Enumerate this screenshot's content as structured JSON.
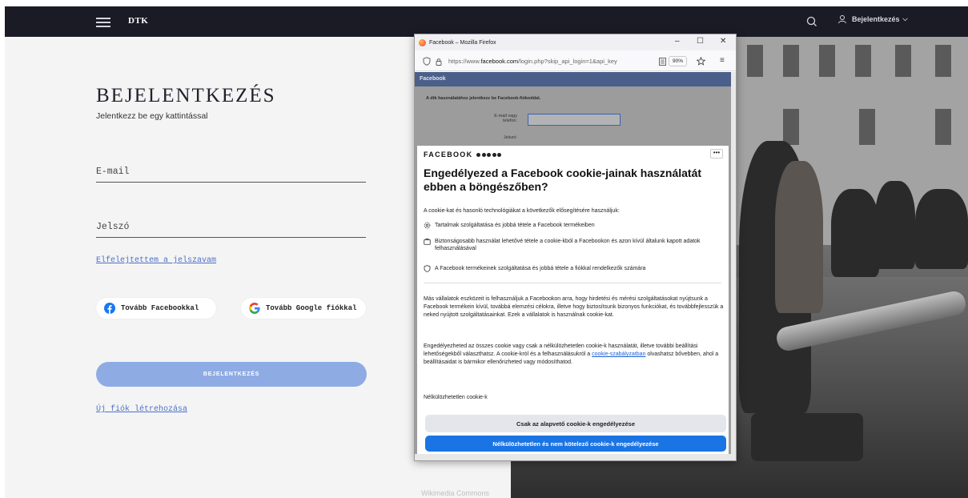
{
  "navbar": {
    "brand": "DTK",
    "user_label": "Bejelentkezés",
    "user_chevron": "⌵"
  },
  "login": {
    "title": "BEJELENTKEZÉS",
    "subtitle": "Jelentkezz be egy kattintással",
    "email_placeholder": "E-mail",
    "password_placeholder": "Jelszó",
    "forgot_link": "Elfelejtettem a jelszavam",
    "facebook_button": "Tovább Facebookkal",
    "google_button": "Tovább Google fiókkal",
    "submit_button": "BEJELENTKEZÉS",
    "register_link": "Új fiók létrehozása"
  },
  "photo": {
    "caption": "Wikimedia Commons"
  },
  "firefox": {
    "window_title": "Facebook – Mozilla Firefox",
    "minimize": "–",
    "maximize": "☐",
    "close": "✕",
    "url_prefix": "https://www.",
    "url_domain": "facebook.com",
    "url_rest": "/login.php?skip_api_login=1&api_key",
    "zoom": "90%",
    "menu": "≡"
  },
  "fb_background": {
    "bar_title": "Facebook",
    "hint": "A dtk használatához jelentkezz be Facebook-fiókoddal.",
    "email_label": "E-mail vagy telefon:",
    "password_label": "Jelszó:"
  },
  "cookie_dialog": {
    "brand": "FACEBOOK",
    "more": "•••",
    "title": "Engedélyezed a Facebook cookie-jainak használatát ebben a böngészőben?",
    "intro": "A cookie-kat és hasonló technológiákat a következők elősegítésére használjuk:",
    "items": [
      "Tartalmak szolgáltatása és jobbá tétele a Facebook termékeiben",
      "Biztonságosabb használat lehetővé tétele a cookie-kból a Facebookon és azon kívül általunk kapott adatok felhasználásával",
      "A Facebook termékeinek szolgáltatása és jobbá tétele a fiókkal rendelkezők számára"
    ],
    "para1": "Más vállalatok eszközeit is felhasználjuk a Facebookon arra, hogy hirdetési és mérési szolgáltatásokat nyújtsunk a Facebook termékein kívül, továbbá elemzési célokra, illetve hogy biztosítsunk bizonyos funkciókat, és továbbfejlesszük a neked nyújtott szolgáltatásainkat. Ezek a vállalatok is használnak cookie-kat.",
    "para2_before": "Engedélyezheted az összes cookie vagy csak a nélkülözhetetlen cookie-k használatát, illetve további beállítási lehetőségekből választhatsz. A cookie-król és a felhasználásukról a ",
    "para2_link": "cookie-szabályzatban",
    "para2_after": " olvashatsz bővebben, ahol a beállításaidat is bármikor ellenőrizheted vagy módosíthatod.",
    "section_heading": "Nélkülözhetetlen cookie-k",
    "btn_basic": "Csak az alapvető cookie-k engedélyezése",
    "btn_essential": "Nélkülözhetetlen és nem kötelező cookie-k engedélyezése"
  },
  "colors": {
    "navbar_bg": "#1b1b26",
    "panel_bg": "#f4f4f4",
    "login_button": "#8fabe4",
    "link": "#4d70c8",
    "fb_blue": "#1b74e4"
  }
}
